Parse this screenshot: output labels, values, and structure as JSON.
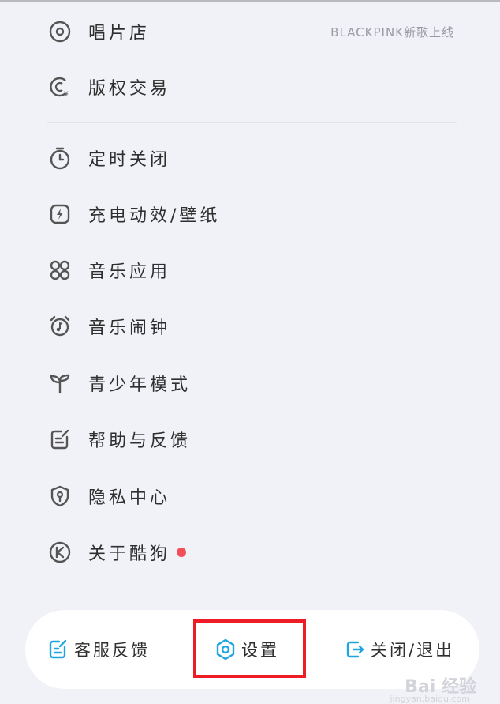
{
  "menu": {
    "items": [
      {
        "label": "唱片店",
        "hint": "BLACKPINK新歌上线",
        "icon": "disc-icon"
      },
      {
        "label": "版权交易",
        "icon": "copyright-trade-icon"
      },
      {
        "label": "定时关闭",
        "icon": "timer-icon"
      },
      {
        "label": "充电动效/壁纸",
        "icon": "charging-wallpaper-icon"
      },
      {
        "label": "音乐应用",
        "icon": "apps-grid-icon"
      },
      {
        "label": "音乐闹钟",
        "icon": "alarm-clock-icon"
      },
      {
        "label": "青少年模式",
        "icon": "sprout-icon"
      },
      {
        "label": "帮助与反馈",
        "icon": "help-feedback-icon"
      },
      {
        "label": "隐私中心",
        "icon": "privacy-shield-icon"
      },
      {
        "label": "关于酷狗",
        "icon": "kugou-k-icon",
        "badge": "red-dot"
      }
    ]
  },
  "bottom_bar": {
    "service_feedback": "客服反馈",
    "settings": "设置",
    "close_exit": "关闭/退出"
  },
  "colors": {
    "background": "#f1f2f8",
    "accent": "#1fa6e0",
    "badge": "#f0505a",
    "highlight_box": "#ee1c25"
  },
  "watermark": {
    "brand": "Bai 经验",
    "url": "jingyan.baidu.com"
  }
}
